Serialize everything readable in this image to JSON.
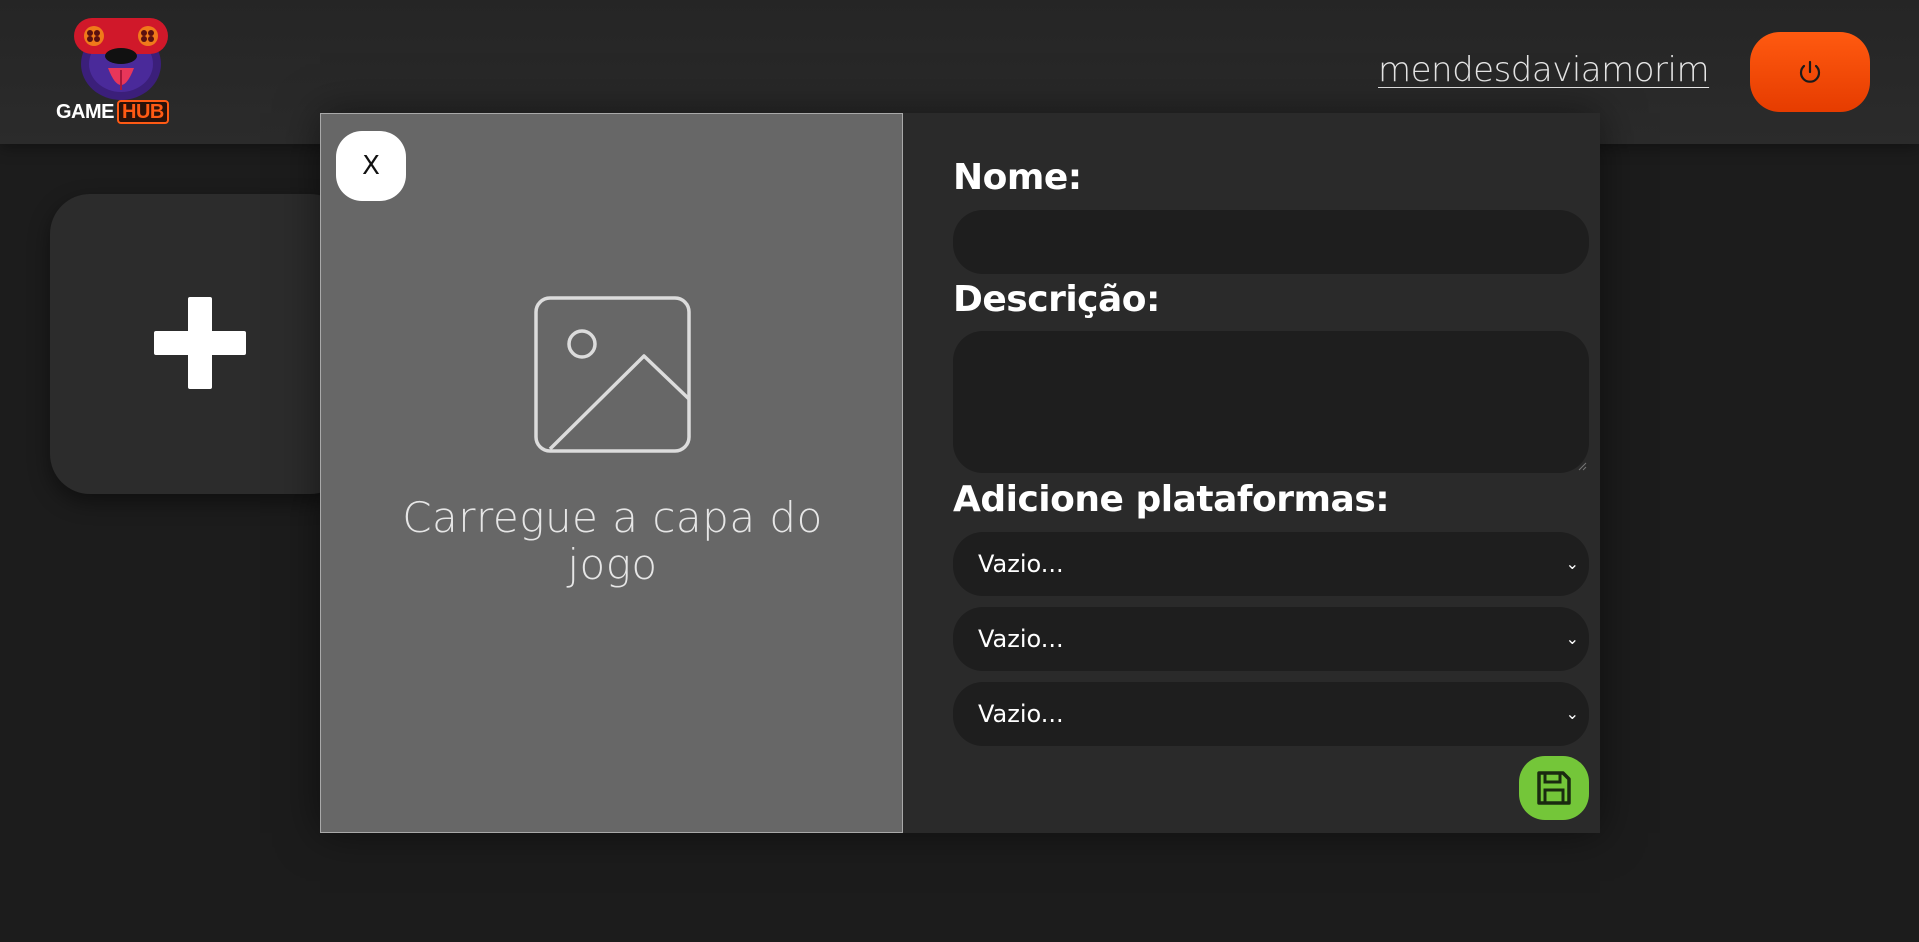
{
  "brand": {
    "logo_word_1": "GAME",
    "logo_word_2": "HUB",
    "accent_color": "#ff5a14"
  },
  "header": {
    "username": "mendesdaviamorim",
    "logout_icon": "power-icon"
  },
  "add_card": {
    "icon": "plus-icon"
  },
  "modal": {
    "close_label": "X",
    "upload": {
      "icon": "image-placeholder-icon",
      "text": "Carregue a capa do jogo"
    },
    "form": {
      "name_label": "Nome:",
      "name_value": "",
      "description_label": "Descrição:",
      "description_value": "",
      "platforms_label": "Adicione plataformas:",
      "platform_selects": [
        {
          "selected": "Vazio..."
        },
        {
          "selected": "Vazio..."
        },
        {
          "selected": "Vazio..."
        }
      ],
      "save_icon": "floppy-disk-icon",
      "save_color": "#74c639"
    }
  }
}
